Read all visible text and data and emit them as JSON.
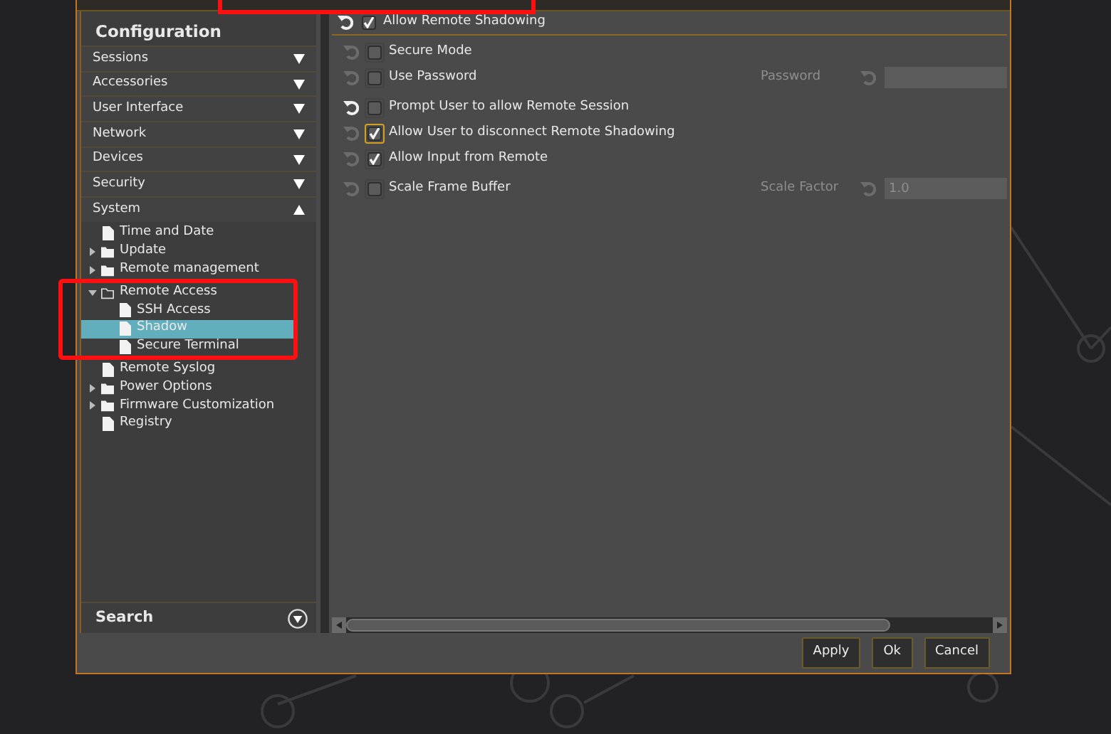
{
  "sidebar": {
    "title": "Configuration",
    "sections": [
      {
        "label": "Sessions",
        "expanded": false
      },
      {
        "label": "Accessories",
        "expanded": false
      },
      {
        "label": "User Interface",
        "expanded": false
      },
      {
        "label": "Network",
        "expanded": false
      },
      {
        "label": "Devices",
        "expanded": false
      },
      {
        "label": "Security",
        "expanded": false
      },
      {
        "label": "System",
        "expanded": true,
        "children": [
          {
            "label": "Time and Date",
            "kind": "file",
            "selected": false
          },
          {
            "label": "Update",
            "kind": "folder",
            "expanded": false,
            "selected": false
          },
          {
            "label": "Remote management",
            "kind": "folder",
            "expanded": false,
            "selected": false
          },
          {
            "label": "Remote Access",
            "kind": "folder",
            "expanded": true,
            "selected": false,
            "highlighted": true,
            "children": [
              {
                "label": "SSH Access",
                "kind": "file",
                "selected": false
              },
              {
                "label": "Shadow",
                "kind": "file",
                "selected": true
              },
              {
                "label": "Secure Terminal",
                "kind": "file",
                "selected": false
              }
            ]
          },
          {
            "label": "Remote Syslog",
            "kind": "file",
            "selected": false
          },
          {
            "label": "Power Options",
            "kind": "folder",
            "expanded": false,
            "selected": false
          },
          {
            "label": "Firmware Customization",
            "kind": "folder",
            "expanded": false,
            "selected": false
          },
          {
            "label": "Registry",
            "kind": "file",
            "selected": false
          }
        ]
      }
    ],
    "search_label": "Search"
  },
  "settings": {
    "header": {
      "label": "Allow Remote Shadowing",
      "checked": true,
      "modified": true
    },
    "rows": [
      {
        "label": "Secure Mode",
        "checked": false,
        "modified": false,
        "focused": false
      },
      {
        "label": "Use Password",
        "checked": false,
        "modified": false,
        "focused": false,
        "field": {
          "label": "Password"
        }
      },
      {
        "label": "Prompt User to allow Remote Session",
        "checked": false,
        "modified": true,
        "focused": false
      },
      {
        "label": "Allow User to disconnect Remote Shadowing",
        "checked": true,
        "modified": false,
        "focused": true
      },
      {
        "label": "Allow Input from Remote",
        "checked": true,
        "modified": false,
        "focused": false
      },
      {
        "label": "Scale Frame Buffer",
        "checked": false,
        "modified": false,
        "focused": false,
        "field": {
          "label": "Scale Factor",
          "value": "1.0"
        }
      }
    ]
  },
  "buttons": [
    "Apply",
    "Ok",
    "Cancel"
  ]
}
